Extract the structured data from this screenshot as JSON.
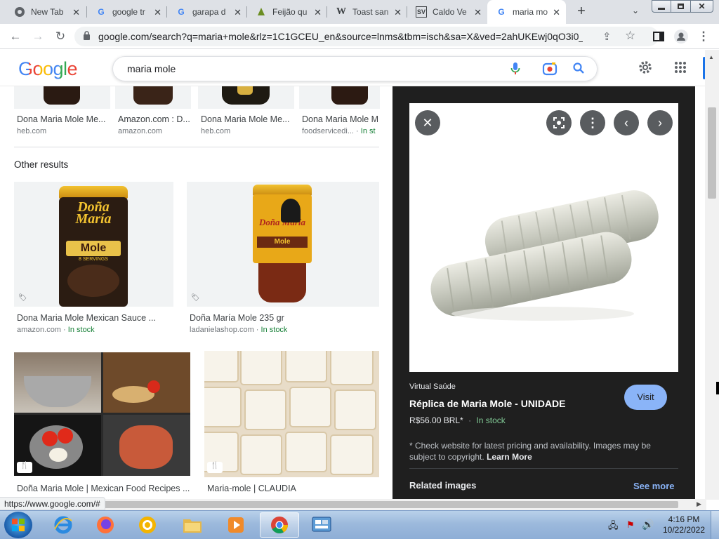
{
  "browser": {
    "tabs": [
      {
        "title": "New Tab",
        "icon": "chrome-icon"
      },
      {
        "title": "google tr",
        "icon": "google-icon"
      },
      {
        "title": "garapa d",
        "icon": "google-icon"
      },
      {
        "title": "Feijão qu",
        "icon": "site-icon"
      },
      {
        "title": "Toast san",
        "icon": "wikipedia-icon"
      },
      {
        "title": "Caldo Ve",
        "icon": "sv-icon"
      },
      {
        "title": "maria mo",
        "icon": "google-icon",
        "active": true
      }
    ],
    "new_tab_label": "+",
    "url": "google.com/search?q=maria+mole&rlz=1C1GCEU_en&source=lnms&tbm=isch&sa=X&ved=2ahUKEwj0qO3i0_...",
    "status_url": "https://www.google.com/#"
  },
  "google": {
    "logo": "Google",
    "search_query": "maria mole"
  },
  "results": {
    "top_row": [
      {
        "caption": "Dona Maria Mole Me...",
        "source": "heb.com"
      },
      {
        "caption": "Amazon.com : D...",
        "source": "amazon.com"
      },
      {
        "caption": "Dona Maria Mole Me...",
        "source": "heb.com"
      },
      {
        "caption": "Dona Maria Mole M",
        "source": "foodservicedi...",
        "stock": "In st"
      }
    ],
    "other_results_heading": "Other results",
    "row2": [
      {
        "caption": "Dona Maria Mole Mexican Sauce ...",
        "source": "amazon.com",
        "stock": "In stock"
      },
      {
        "caption": "Doña María Mole 235 gr",
        "source": "ladanielashop.com",
        "stock": "In stock"
      }
    ],
    "row3": [
      {
        "caption": "Doña Maria Mole | Mexican Food Recipes ...",
        "source": ""
      },
      {
        "caption": "Maria-mole | CLAUDIA",
        "source": ""
      }
    ],
    "jar1_label_brand": "Doña María",
    "jar1_label_product": "Mole",
    "jar1_label_servings": "8 SERVINGS",
    "jar2_label_brand": "Doña María",
    "jar2_label_product": "Mole",
    "separator_dot": "·"
  },
  "panel": {
    "source_site": "Virtual Saúde",
    "title": "Réplica de Maria Mole - UNIDADE",
    "price": "R$56.00 BRL*",
    "stock": "In stock",
    "visit_label": "Visit",
    "disclaimer": "* Check website for latest pricing and availability. Images may be subject to copyright.",
    "learn_more": "Learn More",
    "related_heading": "Related images",
    "see_more": "See more"
  },
  "taskbar": {
    "time": "4:16 PM",
    "date": "10/22/2022"
  },
  "colors": {
    "google_blue": "#4285f4",
    "google_red": "#ea4335",
    "google_yellow": "#fbbc05",
    "google_green": "#34a853",
    "in_stock_green": "#188038",
    "panel_bg": "#1f1f1f",
    "visit_button": "#8ab4f8"
  }
}
